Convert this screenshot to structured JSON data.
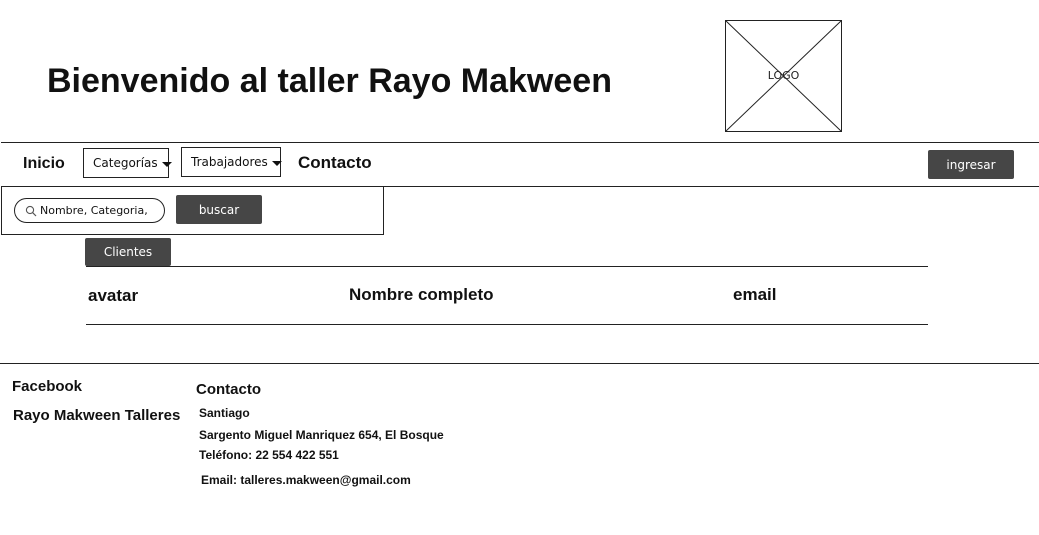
{
  "header": {
    "title": "Bienvenido al taller Rayo Makween",
    "logo_label": "LOGO"
  },
  "nav": {
    "home": "Inicio",
    "categories": "Categorías",
    "workers": "Trabajadores",
    "contact": "Contacto",
    "login_button": "ingresar"
  },
  "search": {
    "placeholder": "Nombre, Categoria,",
    "button": "buscar"
  },
  "clients": {
    "tab_label": "Clientes",
    "columns": [
      "avatar",
      "Nombre completo",
      "email"
    ]
  },
  "footer": {
    "facebook": "Facebook",
    "brand": "Rayo Makween Talleres",
    "contact_heading": "Contacto",
    "city": "Santiago",
    "address": "Sargento Miguel Manriquez 654, El Bosque",
    "phone": "Teléfono: 22 554 422 551",
    "email": "Email: talleres.makween@gmail.com"
  },
  "colors": {
    "button_bg": "#464646",
    "button_text": "#ffffff",
    "border": "#222222",
    "text": "#111111"
  }
}
